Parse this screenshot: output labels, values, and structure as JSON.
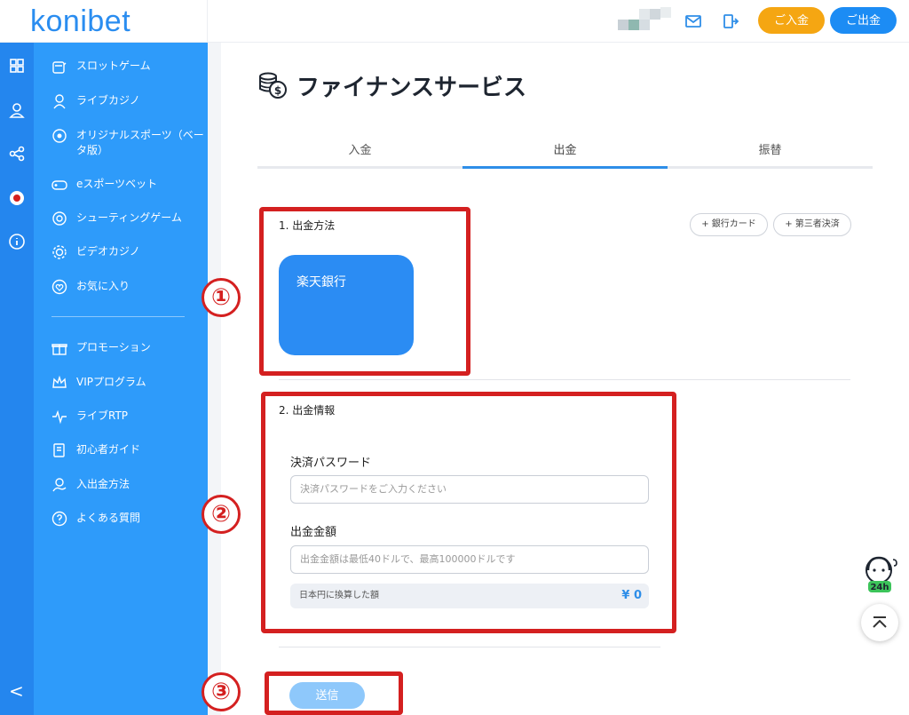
{
  "header": {
    "logo": "konibet",
    "deposit_label": "ご入金",
    "withdraw_label": "ご出金"
  },
  "sidebar": {
    "items": [
      {
        "label": "スロットゲーム",
        "icon": "slot-machine-icon"
      },
      {
        "label": "ライブカジノ",
        "icon": "dealer-icon"
      },
      {
        "label": "オリジナルスポーツ（ベータ版）",
        "icon": "soccer-ball-icon"
      },
      {
        "label": "eスポーツベット",
        "icon": "gamepad-icon"
      },
      {
        "label": "シューティングゲーム",
        "icon": "target-icon"
      },
      {
        "label": "ビデオカジノ",
        "icon": "chip-icon"
      },
      {
        "label": "お気に入り",
        "icon": "heart-icon"
      }
    ],
    "items2": [
      {
        "label": "プロモーション",
        "icon": "gift-icon"
      },
      {
        "label": "VIPプログラム",
        "icon": "crown-icon"
      },
      {
        "label": "ライブRTP",
        "icon": "pulse-icon"
      },
      {
        "label": "初心者ガイド",
        "icon": "guide-icon"
      },
      {
        "label": "入出金方法",
        "icon": "payment-icon"
      },
      {
        "label": "よくある質問",
        "icon": "question-icon"
      }
    ],
    "back": "<"
  },
  "main": {
    "title": "ファイナンスサービス",
    "tabs": [
      {
        "label": "入金",
        "active": false
      },
      {
        "label": "出金",
        "active": true
      },
      {
        "label": "振替",
        "active": false
      }
    ],
    "section1": {
      "label": "1. 出金方法",
      "chip_bank": "+ 銀行カード",
      "chip_third": "+ 第三者決済",
      "bank_name": "楽天銀行"
    },
    "section2": {
      "label": "2. 出金情報",
      "password_label": "決済パスワード",
      "password_placeholder": "決済パスワードをご入力ください",
      "amount_label": "出金金額",
      "amount_placeholder": "出金金額は最低40ドルで、最高100000ドルです",
      "converted_label": "日本円に換算した額",
      "converted_value": "¥ 0"
    },
    "submit_label": "送信"
  },
  "annotations": {
    "marker1": "①",
    "marker2": "②",
    "marker3": "③",
    "color": "#d42020"
  },
  "colors": {
    "accent": "#2e9bfa",
    "rail": "#2486ee",
    "deposit": "#f5a612",
    "withdraw": "#1c8cf4"
  }
}
